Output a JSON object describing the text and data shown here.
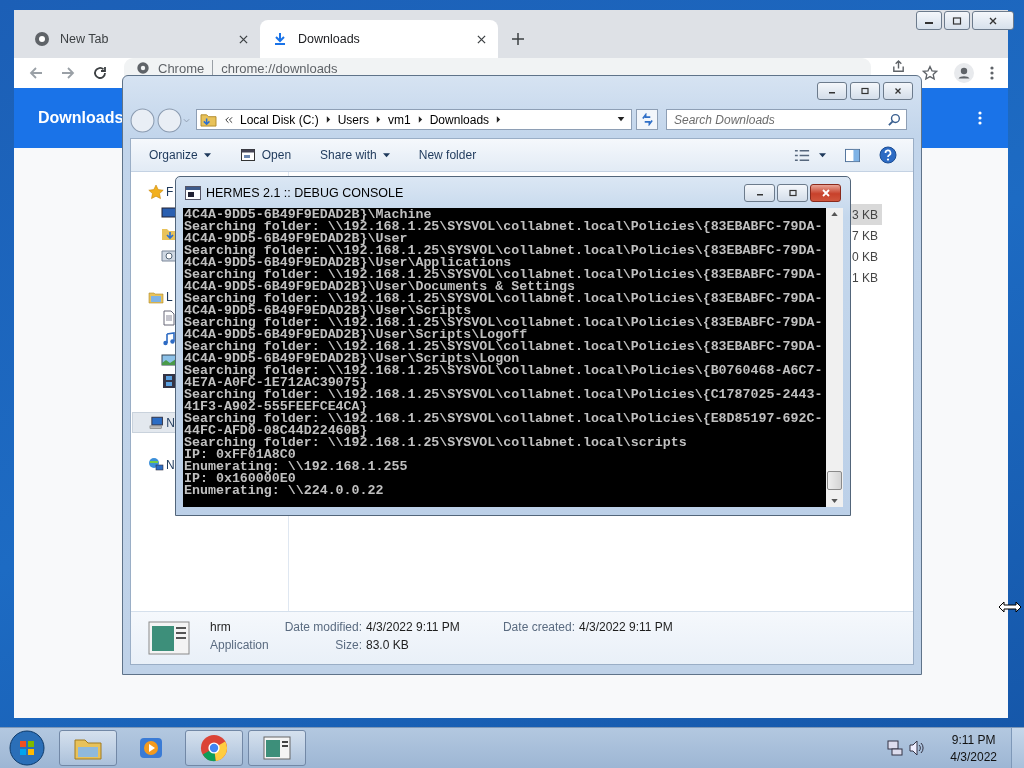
{
  "browser": {
    "tabs": [
      {
        "label": "New Tab",
        "selected": false,
        "kind": "newtab"
      },
      {
        "label": "Downloads",
        "selected": true,
        "kind": "download"
      }
    ],
    "omnibox": {
      "site_label": "Chrome",
      "url": "chrome://downloads"
    },
    "page_title": "Downloads"
  },
  "explorer": {
    "breadcrumb": [
      "Local Disk (C:)",
      "Users",
      "vm1",
      "Downloads"
    ],
    "search": {
      "placeholder": "Search Downloads"
    },
    "toolbar": [
      {
        "label": "Organize",
        "kind": "menu"
      },
      {
        "label": "Open",
        "kind": "open"
      },
      {
        "label": "Share with",
        "kind": "menu"
      },
      {
        "label": "New folder",
        "kind": "plain"
      }
    ],
    "nav": [
      {
        "label": "F",
        "kind": "favorites",
        "selected": false
      },
      {
        "label": "L",
        "kind": "libraries",
        "selected": false
      },
      {
        "label": "N",
        "kind": "computer",
        "selected": true
      },
      {
        "label": "N",
        "kind": "network",
        "selected": false
      }
    ],
    "sizes": [
      {
        "text": "3 KB",
        "selected": true
      },
      {
        "text": "7 KB",
        "selected": false
      },
      {
        "text": "0 KB",
        "selected": false
      },
      {
        "text": "1 KB",
        "selected": false
      }
    ],
    "details": {
      "name": "hrm",
      "type": "Application",
      "fields": [
        {
          "label": "Date modified:",
          "value": "4/3/2022 9:11 PM"
        },
        {
          "label": "Date created:",
          "value": "4/3/2022 9:11 PM"
        },
        {
          "label": "Size:",
          "value": "83.0 KB"
        }
      ]
    }
  },
  "console": {
    "title": "HERMES 2.1 :: DEBUG CONSOLE",
    "lines": [
      "4C4A-9DD5-6B49F9EDAD2B}\\Machine",
      "Searching folder: \\\\192.168.1.25\\SYSVOL\\collabnet.local\\Policies\\{83EBABFC-79DA-",
      "4C4A-9DD5-6B49F9EDAD2B}\\User",
      "Searching folder: \\\\192.168.1.25\\SYSVOL\\collabnet.local\\Policies\\{83EBABFC-79DA-",
      "4C4A-9DD5-6B49F9EDAD2B}\\User\\Applications",
      "Searching folder: \\\\192.168.1.25\\SYSVOL\\collabnet.local\\Policies\\{83EBABFC-79DA-",
      "4C4A-9DD5-6B49F9EDAD2B}\\User\\Documents & Settings",
      "Searching folder: \\\\192.168.1.25\\SYSVOL\\collabnet.local\\Policies\\{83EBABFC-79DA-",
      "4C4A-9DD5-6B49F9EDAD2B}\\User\\Scripts",
      "Searching folder: \\\\192.168.1.25\\SYSVOL\\collabnet.local\\Policies\\{83EBABFC-79DA-",
      "4C4A-9DD5-6B49F9EDAD2B}\\User\\Scripts\\Logoff",
      "Searching folder: \\\\192.168.1.25\\SYSVOL\\collabnet.local\\Policies\\{83EBABFC-79DA-",
      "4C4A-9DD5-6B49F9EDAD2B}\\User\\Scripts\\Logon",
      "Searching folder: \\\\192.168.1.25\\SYSVOL\\collabnet.local\\Policies\\{B0760468-A6C7-",
      "4E7A-A0FC-1E712AC39075}",
      "Searching folder: \\\\192.168.1.25\\SYSVOL\\collabnet.local\\Policies\\{C1787025-2443-",
      "41F3-A902-555FEEFCE4CA}",
      "Searching folder: \\\\192.168.1.25\\SYSVOL\\collabnet.local\\Policies\\{E8D85197-692C-",
      "44FC-AFD0-08C44D22460B}",
      "Searching folder: \\\\192.168.1.25\\SYSVOL\\collabnet.local\\scripts",
      "IP: 0xFF01A8C0",
      "Enumerating: \\\\192.168.1.255",
      "IP: 0x160000E0",
      "Enumerating: \\\\224.0.0.22"
    ]
  },
  "taskbar": {
    "clock": {
      "time": "9:11 PM",
      "date": "4/3/2022"
    }
  }
}
